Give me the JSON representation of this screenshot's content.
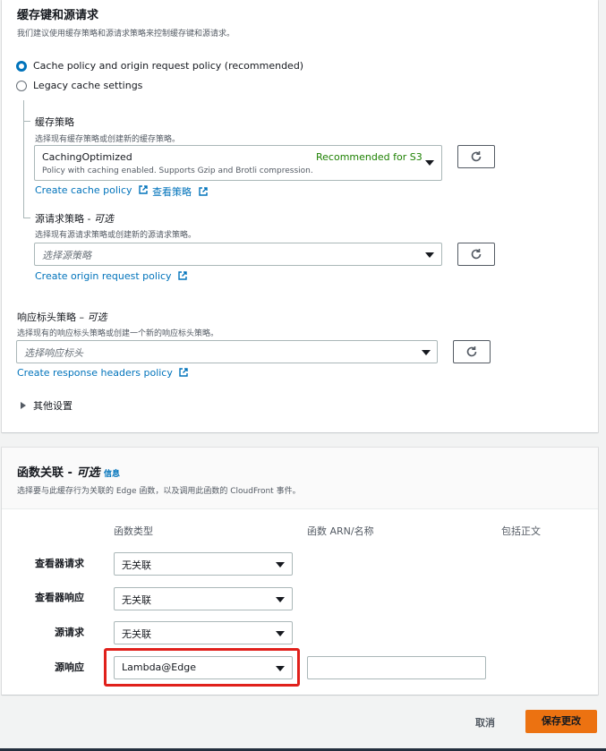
{
  "cache_section": {
    "title": "缓存键和源请求",
    "description": "我们建议使用缓存策略和源请求策略来控制缓存键和源请求。",
    "radio_recommended": "Cache policy and origin request policy (recommended)",
    "radio_legacy": "Legacy cache settings",
    "cache_policy": {
      "label": "缓存策略",
      "description": "选择现有缓存策略或创建新的缓存策略。",
      "selected_value": "CachingOptimized",
      "selected_tag": "Recommended for S3",
      "selected_description": "Policy with caching enabled. Supports Gzip and Brotli compression.",
      "create_link": "Create cache policy",
      "view_link": "查看策略"
    },
    "origin_request_policy": {
      "label": "源请求策略",
      "optional": "可选",
      "description": "选择现有源请求策略或创建新的源请求策略。",
      "placeholder": "选择源策略",
      "create_link": "Create origin request policy"
    }
  },
  "response_headers": {
    "label": "响应标头策略",
    "optional": "可选",
    "description": "选择现有的响应标头策略或创建一个新的响应标头策略。",
    "placeholder": "选择响应标头",
    "create_link": "Create response headers policy"
  },
  "other_settings": "其他设置",
  "function_section": {
    "title": "函数关联",
    "optional": "可选",
    "info": "信息",
    "description": "选择要与此缓存行为关联的 Edge 函数，以及调用此函数的 CloudFront 事件。",
    "col_type": "函数类型",
    "col_arn": "函数 ARN/名称",
    "col_body": "包括正文",
    "rows": [
      {
        "label": "查看器请求",
        "value": "无关联"
      },
      {
        "label": "查看器响应",
        "value": "无关联"
      },
      {
        "label": "源请求",
        "value": "无关联"
      },
      {
        "label": "源响应",
        "value": "Lambda@Edge"
      }
    ]
  },
  "footer": {
    "cancel": "取消",
    "save": "保存更改"
  },
  "colors": {
    "link": "#0073bb",
    "recommended": "#1d8102",
    "primary": "#ec7211",
    "highlight": "#e0201b"
  }
}
